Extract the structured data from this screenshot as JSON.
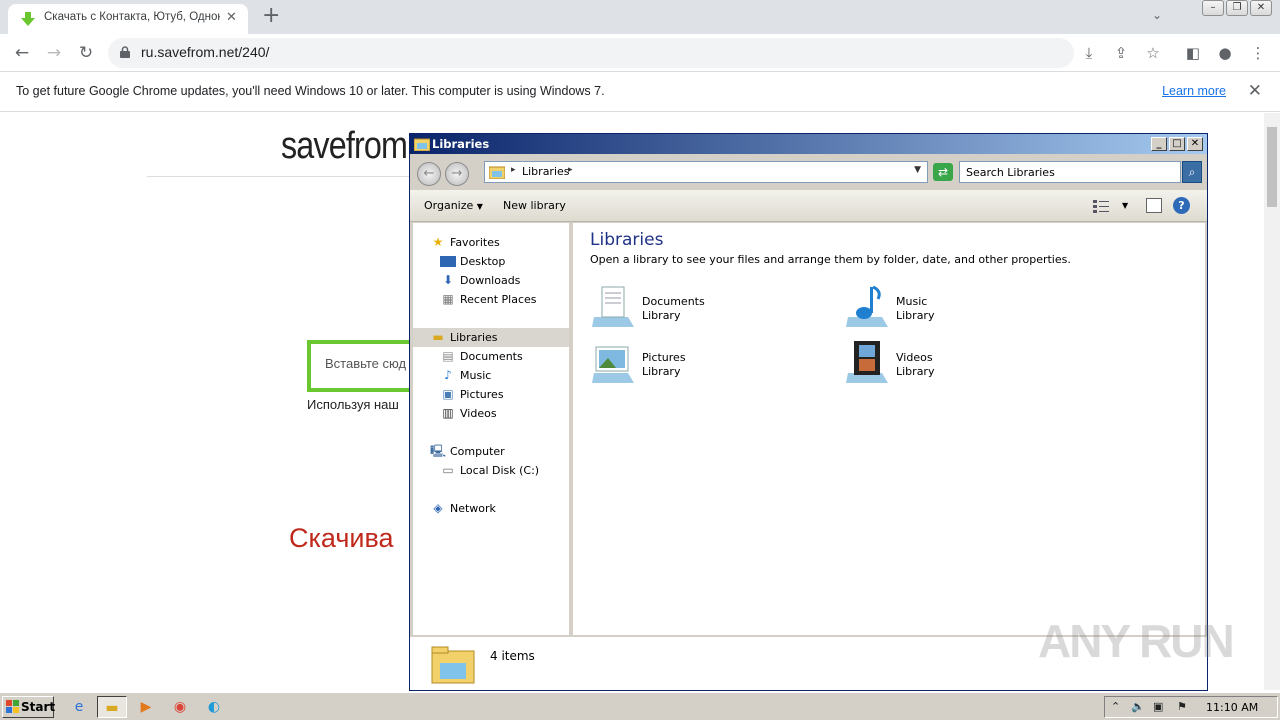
{
  "browser": {
    "tab_title": "Скачать с Контакта, Ютуб, Одноклассников",
    "url": "ru.savefrom.net/240/",
    "newtab_icon": "plus-icon",
    "infobar_text": "To get future Google Chrome updates, you'll need Windows 10 or later. This computer is using Windows 7.",
    "infobar_link": "Learn more"
  },
  "page": {
    "logo": "savefrom.",
    "paste_placeholder": "Вставьте сюд",
    "using_text": "Используя наш",
    "download_heading": "Скачива"
  },
  "explorer": {
    "title": "Libraries",
    "address": "Libraries",
    "search_placeholder": "Search Libraries",
    "commands": {
      "organize": "Organize",
      "new_library": "New library"
    },
    "nav": {
      "favorites": "Favorites",
      "desktop": "Desktop",
      "downloads": "Downloads",
      "recent_places": "Recent Places",
      "libraries": "Libraries",
      "documents": "Documents",
      "music": "Music",
      "pictures": "Pictures",
      "videos": "Videos",
      "computer": "Computer",
      "local_disk": "Local Disk (C:)",
      "network": "Network"
    },
    "heading": "Libraries",
    "subheading": "Open a library to see your files and arrange them by folder, date, and other properties.",
    "libraries": [
      {
        "name": "Documents",
        "type": "Library"
      },
      {
        "name": "Music",
        "type": "Library"
      },
      {
        "name": "Pictures",
        "type": "Library"
      },
      {
        "name": "Videos",
        "type": "Library"
      }
    ],
    "status": "4 items"
  },
  "taskbar": {
    "start": "Start",
    "time": "11:10 AM"
  },
  "watermark": "ANY RUN"
}
